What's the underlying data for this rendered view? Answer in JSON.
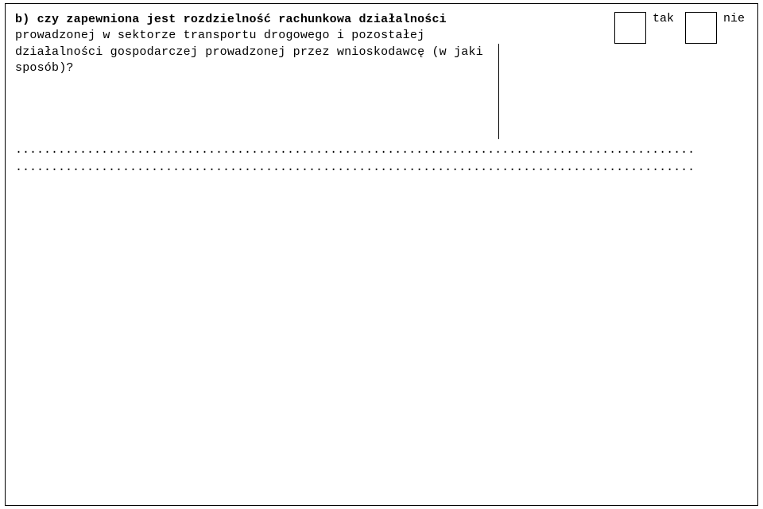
{
  "question": {
    "prefix": "b) czy zapewniona jest rozdzielność rachunkowa działalności",
    "line2": "prowadzonej w sektorze transportu drogowego i pozostałej",
    "line3": "działalności gospodarczej prowadzonej przez wnioskodawcę (w jaki",
    "line4": "sposób)?"
  },
  "options": {
    "yes": "tak",
    "no": "nie"
  },
  "fill": {
    "dots1": "...............................................................................................",
    "dots2": "..............................................................................................."
  }
}
